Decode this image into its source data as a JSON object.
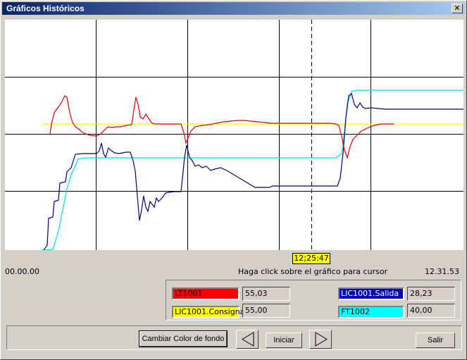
{
  "window": {
    "title": "Gráficos Históricos",
    "close_glyph": "✕"
  },
  "chart": {
    "grid": true,
    "y_gridlines": 3,
    "x_gridlines": 4,
    "cursor_time": "12;25:47"
  },
  "time_axis": {
    "start": "00.00.00",
    "end": "12.31.53",
    "hint": "Haga click sobre el gráfico para cursor"
  },
  "series": [
    {
      "tag": "LT1001",
      "value": "55,03",
      "color": "#ff0000"
    },
    {
      "tag": "LIC1001.Consigna",
      "value": "55,00",
      "color": "#ffff00"
    },
    {
      "tag": "LIC1001.Salida",
      "value": "28,23",
      "color": "#0000c0"
    },
    {
      "tag": "FT1002",
      "value": "40,00",
      "color": "#00ffff"
    }
  ],
  "buttons": {
    "bgcolor": "Cambiar Color de fondo",
    "back_icon": "triangle-left-icon",
    "start": "Iniciar",
    "forward_icon": "triangle-right-icon",
    "exit": "Salir"
  }
}
